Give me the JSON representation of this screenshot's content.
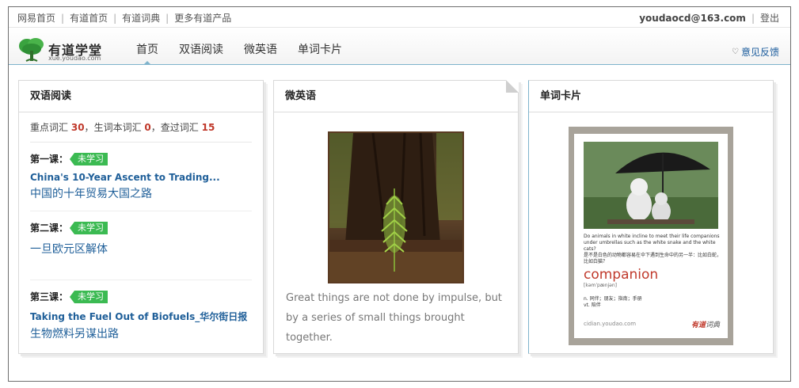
{
  "topbar": {
    "links": [
      "网易首页",
      "有道首页",
      "有道词典",
      "更多有道产品"
    ],
    "email": "youdaocd@163.com",
    "logout": "登出"
  },
  "header": {
    "logo_title": "有道学堂",
    "logo_url": "xue.youdao.com",
    "nav": [
      "首页",
      "双语阅读",
      "微英语",
      "单词卡片"
    ],
    "active_nav": "首页",
    "feedback": "意见反馈"
  },
  "bilingual": {
    "title": "双语阅读",
    "stats": {
      "key_label": "重点词汇",
      "key_count": "30",
      "sep1": "，",
      "vocab_label": "生词本词汇",
      "vocab_count": "0",
      "sep2": "，",
      "lookup_label": "查过词汇",
      "lookup_count": "15"
    },
    "lessons": [
      {
        "label": "第一课：",
        "badge": "未学习",
        "en": "China's 10-Year Ascent to Trading...",
        "cn": "中国的十年贸易大国之路"
      },
      {
        "label": "第二课：",
        "badge": "未学习",
        "en": "",
        "cn": "一旦欧元区解体"
      },
      {
        "label": "第三课：",
        "badge": "未学习",
        "en": "Taking the Fuel Out of Biofuels_华尔街日报",
        "cn": "生物燃料另谋出路"
      }
    ]
  },
  "micro": {
    "title": "微英语",
    "quote": "Great things are not done by impulse, but by a series of small things brought together."
  },
  "wordcard": {
    "title": "单词卡片",
    "sentence_en": "Do animals in white incline to meet their life companions under umbrellas such as the white snake and the white cats?",
    "sentence_cn": "是不是白色的动物都容易在伞下遇到生命中的另一半：比如白蛇，比如白猫？",
    "word": "companion",
    "phonetic": "[kəmˈpænjən]",
    "def1": "n. 同伴；朋友；指南；手册",
    "def2": "vt. 陪伴",
    "site": "cidian.youdao.com",
    "brand_red": "有道",
    "brand_rest": "词典"
  },
  "colors": {
    "accent_blue": "#1f5f99",
    "badge_green": "#3bba52",
    "count_red": "#c0392b",
    "header_line": "#7fb3cc"
  }
}
